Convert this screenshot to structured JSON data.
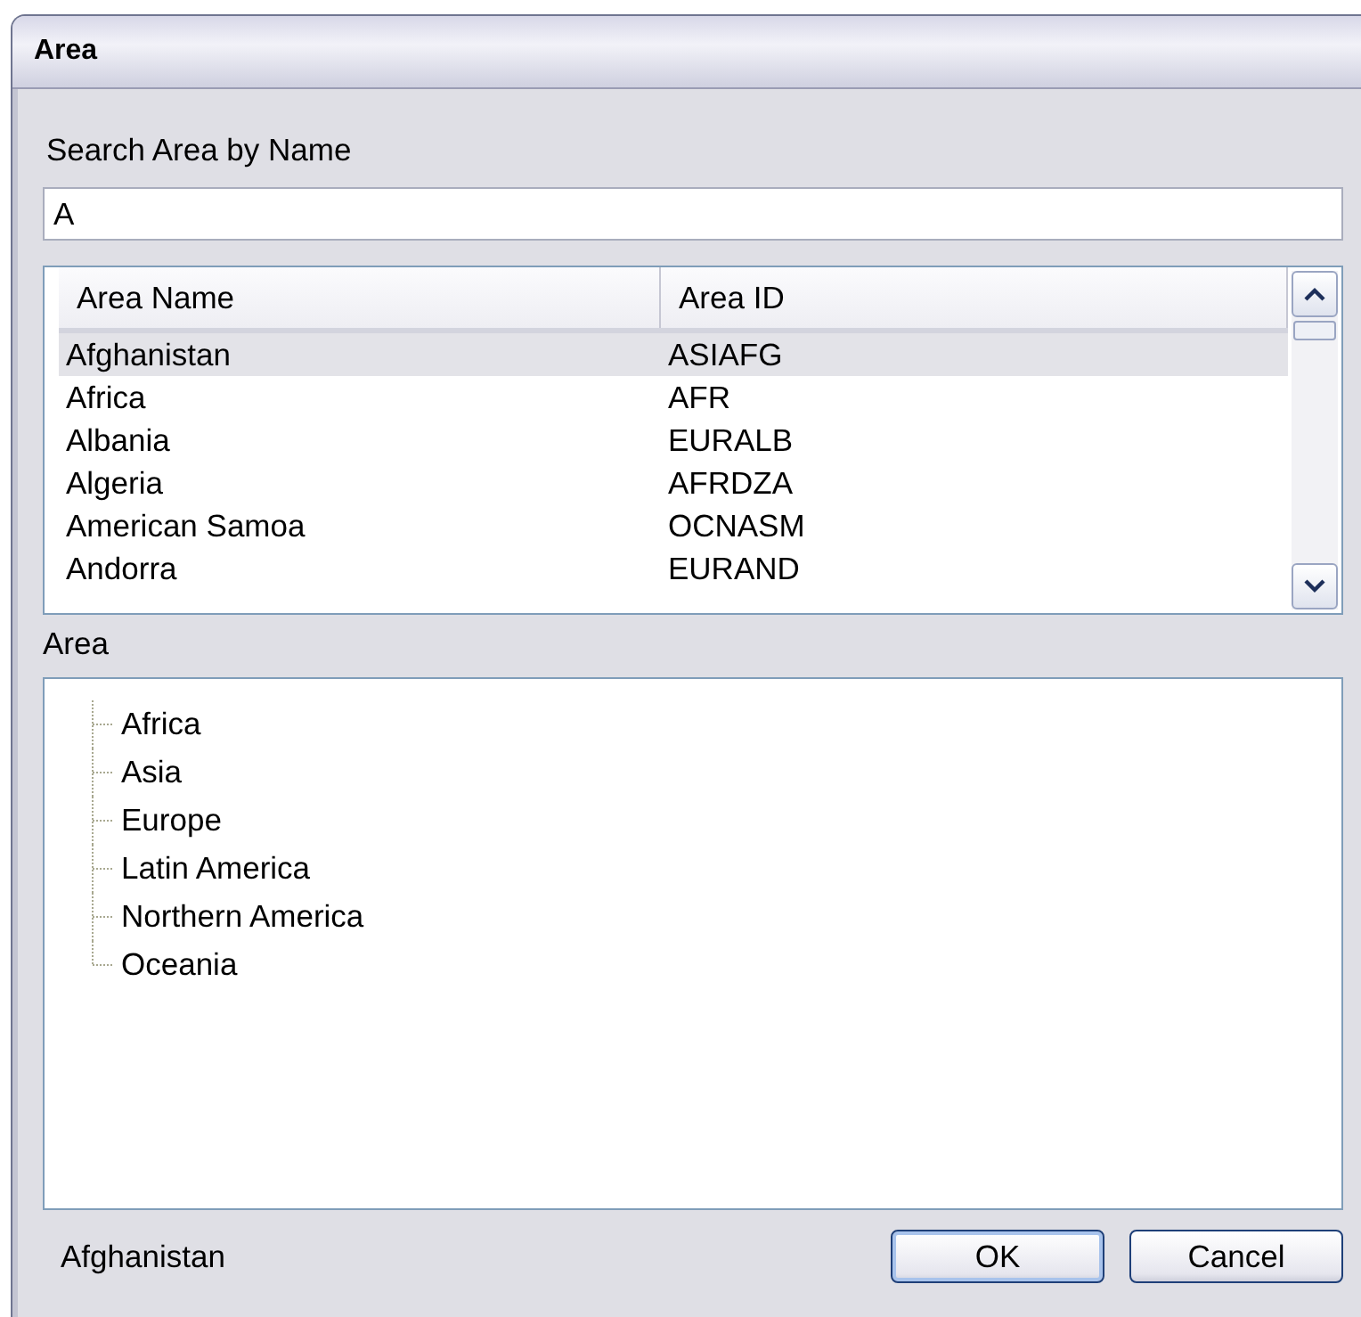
{
  "window": {
    "title": "Area"
  },
  "search": {
    "label": "Search Area by Name",
    "value": "A"
  },
  "table": {
    "columns": [
      "Area Name",
      "Area ID"
    ],
    "rows": [
      {
        "name": "Afghanistan",
        "id": "ASIAFG",
        "selected": true
      },
      {
        "name": "Africa",
        "id": "AFR",
        "selected": false
      },
      {
        "name": "Albania",
        "id": "EURALB",
        "selected": false
      },
      {
        "name": "Algeria",
        "id": "AFRDZA",
        "selected": false
      },
      {
        "name": "American Samoa",
        "id": "OCNASM",
        "selected": false
      },
      {
        "name": "Andorra",
        "id": "EURAND",
        "selected": false
      }
    ]
  },
  "tree": {
    "label": "Area",
    "items": [
      {
        "label": "Africa"
      },
      {
        "label": "Asia"
      },
      {
        "label": "Europe"
      },
      {
        "label": "Latin America"
      },
      {
        "label": "Northern America"
      },
      {
        "label": "Oceania"
      }
    ]
  },
  "status_bar": {
    "text": "Afghanistan"
  },
  "buttons": [
    "OK",
    "Cancel"
  ]
}
